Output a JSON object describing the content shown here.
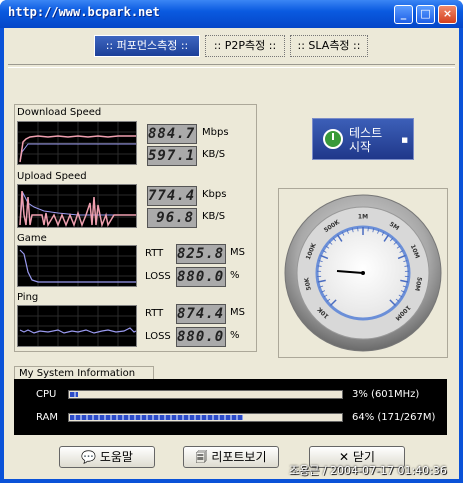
{
  "window": {
    "title": "http://www.bcpark.net",
    "min": "_",
    "max": "□",
    "close": "×"
  },
  "tabs": [
    {
      "label": ":: 퍼포먼스측정 ::"
    },
    {
      "label": ":: P2P측정 ::"
    },
    {
      "label": ":: SLA측정 ::"
    }
  ],
  "metrics": {
    "download": {
      "label": "Download Speed",
      "v1": "884.7",
      "u1": "Mbps",
      "v2": "597.1",
      "u2": "KB/S"
    },
    "upload": {
      "label": "Upload Speed",
      "v1": "774.4",
      "u1": "Kbps",
      "v2": "96.8",
      "u2": "KB/S"
    },
    "game": {
      "label": "Game",
      "l1": "RTT",
      "v1": "825.8",
      "u1": "MS",
      "l2": "LOSS",
      "v2": "880.0",
      "u2": "%"
    },
    "ping": {
      "label": "Ping",
      "l1": "RTT",
      "v1": "874.4",
      "u1": "MS",
      "l2": "LOSS",
      "v2": "880.0",
      "u2": "%"
    }
  },
  "start_button": {
    "line1": "테스트",
    "line2": "시작"
  },
  "gauge": {
    "labels": [
      "10K",
      "50K",
      "100K",
      "500K",
      "1M",
      "5M",
      "10M",
      "50M",
      "100M"
    ],
    "needle": "10K"
  },
  "sysinfo": {
    "title": "My System Information",
    "cpu": {
      "label": "CPU",
      "text": "3% (601MHz)",
      "fraction": 0.03
    },
    "ram": {
      "label": "RAM",
      "text": "64% (171/267M)",
      "fraction": 0.64
    }
  },
  "buttons": {
    "help": "도움말",
    "report": "리포트보기",
    "close": "닫기"
  },
  "status": "조용근 / 2004-07-17 01:40:36",
  "colors": {
    "titlebar": "#0a5ae0",
    "accent": "#2c4bc8",
    "graph_line_pink": "#f0a0b0",
    "graph_line_blue": "#9a9af0"
  }
}
